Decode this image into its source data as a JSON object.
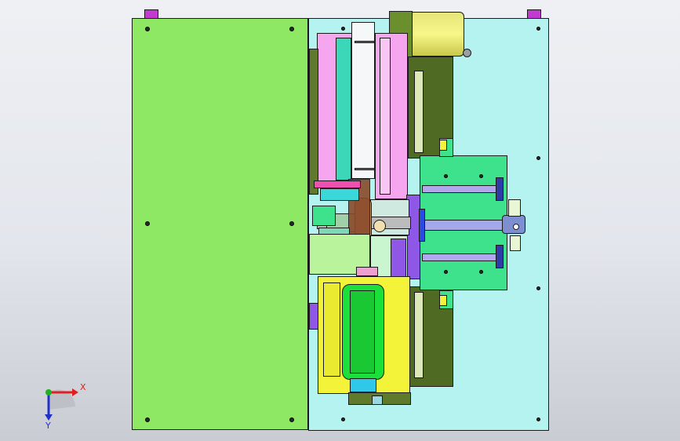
{
  "viewport": {
    "title": "",
    "background_gradient": [
      "#eef0f4",
      "#c9ccd3"
    ]
  },
  "triad": {
    "x_label": "X",
    "y_label": "Y",
    "x_color": "#e02020",
    "y_color": "#2030c8",
    "origin_color": "#20b020"
  },
  "colors": {
    "left_plate": "#8ee864",
    "base_plate": "#b5f3f0",
    "pink": "#f5a6ee",
    "mint": "#3fe28c",
    "yellow": "#f3f33a",
    "green": "#1be03a",
    "violet": "#8e57e6",
    "olive": "#5e7a2a",
    "cyan": "#30c8e8",
    "tan": "#c49a63"
  }
}
